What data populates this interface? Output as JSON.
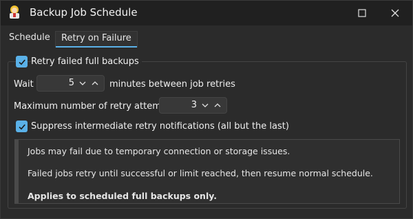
{
  "window": {
    "title": "Backup Job Schedule",
    "icons": {
      "app": "backup-agent-icon",
      "maximize": "maximize-icon",
      "close": "close-icon"
    }
  },
  "tabs": [
    {
      "label": "Schedule",
      "active": false
    },
    {
      "label": "Retry on Failure",
      "active": true
    }
  ],
  "retry": {
    "enable_label": "Retry failed full backups",
    "enable_checked": true,
    "wait_prefix": "Wait",
    "wait_value": "5",
    "wait_suffix": "minutes between job retries",
    "max_label": "Maximum number of retry attempts:",
    "max_value": "3",
    "suppress_label": "Suppress intermediate retry notifications (all but the last)",
    "suppress_checked": true
  },
  "info": {
    "line1": "Jobs may fail due to temporary connection or storage issues.",
    "line2": "Failed jobs retry until successful or limit reached, then resume normal schedule.",
    "line3": "Applies to scheduled full backups only."
  },
  "colors": {
    "accent": "#5ab1e8",
    "background": "#2b2b2b",
    "titlebar": "#202020"
  }
}
